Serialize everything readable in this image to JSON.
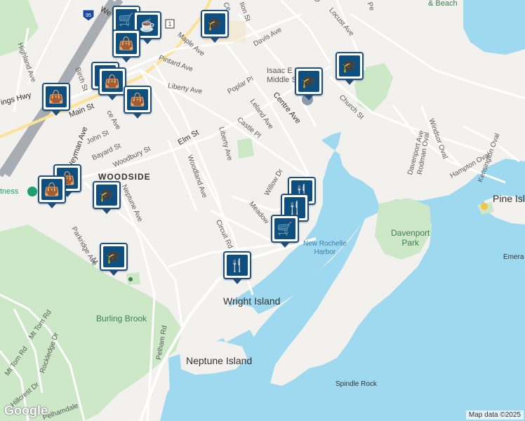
{
  "map": {
    "colors": {
      "land": "#f2f1ee",
      "water": "#9fd9f0",
      "park": "#cce8c7",
      "road": "#ffffff",
      "highway": "#a8adb4",
      "marker": "#0d4f80"
    },
    "areas": {
      "woodside": "WOODSIDE",
      "wright_island": "Wright Island",
      "neptune_island": "Neptune Island",
      "davenport_park": "Davenport\nPark",
      "burling_brook": "Burling Brook",
      "harbor": "New Rochelle\nHarbor",
      "spindle_rock": "Spindle Rock",
      "pine_island": "Pine Isl",
      "emerald": "Emera",
      "school": "Isaac E Young\nMiddle School",
      "fitness": "tness",
      "top_right": "& Beach"
    },
    "streets": {
      "main_st": "Main St",
      "weyman_ave": "Weyman Ave",
      "highland_ave": "Highland Ave",
      "kings_hwy": "ings Hwy",
      "birch_st": "Birch St",
      "pintard_ave": "Pintard Ave",
      "maple_ave": "Maple Ave",
      "davis_ave": "Davis Ave",
      "liberty_ave": "Liberty Ave",
      "liberty_ave2": "Liberty Ave",
      "poplar_pl": "Poplar Pl",
      "elm_st": "Elm St",
      "john_st": "John St",
      "bayard_st": "Bayard St",
      "woodbury_st": "Woodbury St",
      "woodland_ave": "Woodland Ave",
      "neptune_ave": "Neptune Ave",
      "parkridge_ave": "Parkridge Ave",
      "circuit_rd": "Circuit Rd",
      "meadow": "Meadow",
      "willow_dr": "Willow Dr",
      "leland_ave": "Leland Ave",
      "castle_pl": "Castle Pl",
      "centre_ave": "Centre Ave",
      "church_st": "Church St",
      "locust_ave": "Locust Ave",
      "davenport_ave": "Davenport Ave",
      "windsor_oval": "Windsor Oval",
      "rodman_oval": "Rodman Oval",
      "hampton_oval": "Hampton Oval",
      "kensington_oval": "Kensington Oval",
      "pelham_rd": "Pelham Rd",
      "mt_tom_rd": "Mt Tom Rd",
      "mt_tom_rd2": "Mt Tom Rd",
      "rockledge_dr": "Rockledge Dr",
      "hillcrest_dr": "Hillcrest Dr",
      "pelhamdale": "Pelhamdale",
      "ce": "Ce",
      "union_st": "tion St",
      "we": "We",
      "pe": "Pe",
      "un": "Un",
      "co": "ce Ave",
      "n": "M"
    },
    "shields": {
      "i95": "95",
      "us1": "1"
    },
    "markers": [
      {
        "type": "cart",
        "icon": "🛒"
      },
      {
        "type": "coffee",
        "icon": "☕"
      },
      {
        "type": "school",
        "icon": "🎓"
      },
      {
        "type": "bag",
        "icon": "👜"
      },
      {
        "type": "cart",
        "icon": "🛒"
      },
      {
        "type": "bag",
        "icon": "👜"
      },
      {
        "type": "bag",
        "icon": "👜"
      },
      {
        "type": "school",
        "icon": "🎓"
      },
      {
        "type": "school",
        "icon": "🎓"
      },
      {
        "type": "bag",
        "icon": "👜"
      },
      {
        "type": "bag",
        "icon": "👜"
      },
      {
        "type": "bag",
        "icon": "👜"
      },
      {
        "type": "school",
        "icon": "🎓"
      },
      {
        "type": "restaurant",
        "icon": "🍴"
      },
      {
        "type": "restaurant",
        "icon": "🍴"
      },
      {
        "type": "cart",
        "icon": "🛒"
      },
      {
        "type": "school",
        "icon": "🎓"
      },
      {
        "type": "restaurant",
        "icon": "🍴"
      }
    ],
    "google_logo": "Google",
    "attribution": "Map data ©2025"
  }
}
